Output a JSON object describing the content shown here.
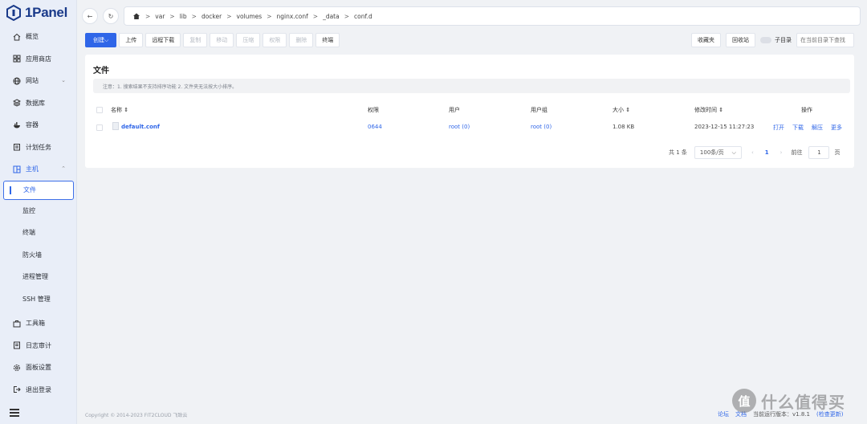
{
  "app": {
    "name": "1Panel"
  },
  "sidebar": {
    "items": [
      {
        "label": "概览",
        "icon": "home-icon"
      },
      {
        "label": "应用商店",
        "icon": "grid-icon"
      },
      {
        "label": "网站",
        "icon": "globe-icon",
        "expandable": true
      },
      {
        "label": "数据库",
        "icon": "database-icon"
      },
      {
        "label": "容器",
        "icon": "container-icon"
      },
      {
        "label": "计划任务",
        "icon": "calendar-icon"
      },
      {
        "label": "主机",
        "icon": "host-icon",
        "expanded": true
      },
      {
        "label": "文件",
        "sub": true,
        "active": true
      },
      {
        "label": "监控",
        "sub": true
      },
      {
        "label": "终端",
        "sub": true
      },
      {
        "label": "防火墙",
        "sub": true
      },
      {
        "label": "进程管理",
        "sub": true
      },
      {
        "label": "SSH 管理",
        "sub": true
      },
      {
        "label": "工具箱",
        "icon": "toolbox-icon"
      },
      {
        "label": "日志审计",
        "icon": "log-icon"
      },
      {
        "label": "面板设置",
        "icon": "gear-icon"
      },
      {
        "label": "退出登录",
        "icon": "logout-icon"
      }
    ]
  },
  "breadcrumb": [
    "var",
    "lib",
    "docker",
    "volumes",
    "nginx.conf",
    "_data",
    "conf.d"
  ],
  "toolbar": {
    "create": "创建",
    "upload": "上传",
    "remote_download": "远程下载",
    "copy": "复制",
    "move": "移动",
    "compress": "压缩",
    "permission": "权限",
    "delete": "删除",
    "terminal": "终端",
    "favorites": "收藏夹",
    "recycle_bin": "回收站",
    "subdir_label": "子目录",
    "search_placeholder": "在当前目录下查找"
  },
  "file_panel": {
    "title": "文件",
    "notice": "注意：1. 搜索结果不支持排序功能 2. 文件夹无法按大小排序。",
    "columns": {
      "name": "名称",
      "permission": "权限",
      "user": "用户",
      "group": "用户组",
      "size": "大小",
      "modified": "修改时间",
      "actions": "操作"
    },
    "rows": [
      {
        "name": "default.conf",
        "permission": "0644",
        "user": "root (0)",
        "group": "root (0)",
        "size": "1.08 KB",
        "modified": "2023-12-15 11:27:23",
        "actions": [
          "打开",
          "下载",
          "解压",
          "更多"
        ]
      }
    ],
    "pagination": {
      "total": "共 1 条",
      "page_size": "100条/页",
      "current_page": "1",
      "goto_label": "前往",
      "goto_value": "1",
      "page_suffix": "页"
    }
  },
  "footer": {
    "copyright": "Copyright © 2014-2023 FIT2CLOUD 飞致云",
    "forum": "论坛",
    "docs": "文档",
    "version_label": "当前运行版本：v1.8.1",
    "check_update": "(检查更新)"
  },
  "watermark": {
    "text": "什么值得买",
    "badge": "值"
  },
  "colors": {
    "accent": "#2f66e8",
    "sidebar_bg": "#e9eef8",
    "page_bg": "#f0f2f5"
  }
}
